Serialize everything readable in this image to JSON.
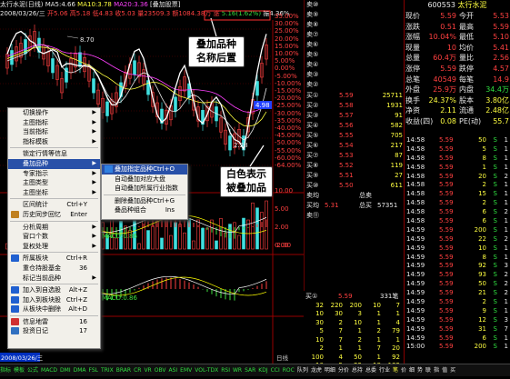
{
  "chart_header": {
    "line1_name": "太行水泥(日线)",
    "line1_ma5": "MA5:4.66",
    "line1_ma10": "MA10:3.78",
    "line1_ma20": "MA20:3.36",
    "line1_tag": "[叠加股票]",
    "line2_date": "2008/03/26/三",
    "line2_vals": "开5.06 高5.18 低4.83 收5.03 量23509.3 额1084.38万 涨",
    "line2_chg": "5.16(1.62%)",
    "line2_amp": "振4.36% 换"
  },
  "chart_marks": {
    "high_label": "8.70",
    "low_label": "2.28",
    "price_tag": "4.98",
    "macd1": "MACD:0.86",
    "macd2": "MACD:0.86",
    "date_label": "2008/03/26/三",
    "period_label": "日线"
  },
  "y_axis": [
    "35.00%",
    "30.00%",
    "25.00%",
    "20.00%",
    "15.00%",
    "10.00%",
    "5.00%",
    "0.00%",
    "-5.00%",
    "-10.00%",
    "-15.00%",
    "-20.00%",
    "-25.00%",
    "-30.00%",
    "-35.00%",
    "-40.00%",
    "-45.00%",
    "-50.00%",
    "-55.00%",
    "-60.00%",
    "-64.00%",
    "10.00",
    "5.00",
    "2.00",
    "0.00",
    "-2.00"
  ],
  "order_book": {
    "sells": [
      [
        "卖⑩",
        "",
        ""
      ],
      [
        "卖⑨",
        "",
        ""
      ],
      [
        "卖⑧",
        "",
        ""
      ],
      [
        "卖⑦",
        "",
        ""
      ],
      [
        "卖⑥",
        "",
        ""
      ],
      [
        "卖⑤",
        "",
        ""
      ],
      [
        "卖④",
        "",
        ""
      ],
      [
        "卖③",
        "",
        ""
      ],
      [
        "卖②",
        "",
        ""
      ]
    ],
    "buys": [
      [
        "买①",
        "5.59",
        "25711"
      ],
      [
        "买②",
        "5.58",
        "1931"
      ],
      [
        "买③",
        "5.57",
        "91"
      ],
      [
        "买④",
        "5.56",
        "582"
      ],
      [
        "买⑤",
        "5.55",
        "705"
      ],
      [
        "买⑥",
        "5.54",
        "217"
      ],
      [
        "买⑦",
        "5.53",
        "87"
      ],
      [
        "买⑧",
        "5.52",
        "119"
      ],
      [
        "买⑨",
        "5.51",
        "27"
      ],
      [
        "买⑩",
        "5.50",
        "611"
      ]
    ],
    "summary1_label": "总卖",
    "summary1": "卖均",
    "summary2_label": "总买",
    "summary2_price": "5.31",
    "summary2_vol": "57351",
    "summary2": "买均",
    "last": "卖⑪"
  },
  "quote": {
    "code": "600553",
    "name": "太行水泥",
    "rows": [
      [
        "现价",
        "5.59",
        "今开",
        "5.53"
      ],
      [
        "涨跌",
        "0.51",
        "最高",
        "5.59"
      ],
      [
        "涨幅",
        "10.04%",
        "最低",
        "5.10"
      ],
      [
        "现量",
        "10",
        "均价",
        "5.41"
      ],
      [
        "总量",
        "60.4万",
        "量比",
        "2.56"
      ],
      [
        "涨停",
        "5.59",
        "跌停",
        "4.57"
      ],
      [
        "总笔",
        "40549",
        "每笔",
        "14.9"
      ],
      [
        "外盘",
        "25.9万",
        "内盘",
        "34.4万"
      ],
      [
        "换手",
        "24.37%",
        "股本",
        "3.80亿"
      ],
      [
        "净资",
        "2.11",
        "流通",
        "2.48亿"
      ],
      [
        "收益(四)",
        "0.08",
        "PE(动)",
        "55.7"
      ]
    ]
  },
  "ticks": [
    [
      "14:58",
      "5.59",
      "50",
      "S",
      "1"
    ],
    [
      "14:58",
      "5.59",
      "5",
      "S",
      "1"
    ],
    [
      "14:58",
      "5.59",
      "8",
      "S",
      "1"
    ],
    [
      "14:58",
      "5.59",
      "1",
      "S",
      "1"
    ],
    [
      "14:58",
      "5.59",
      "20",
      "S",
      "2"
    ],
    [
      "14:58",
      "5.59",
      "2",
      "S",
      "1"
    ],
    [
      "14:58",
      "5.59",
      "15",
      "S",
      "1"
    ],
    [
      "14:58",
      "5.59",
      "2",
      "S",
      "1"
    ],
    [
      "14:58",
      "5.59",
      "6",
      "S",
      "2"
    ],
    [
      "14:58",
      "5.59",
      "6",
      "S",
      "1"
    ],
    [
      "14:59",
      "5.59",
      "200",
      "S",
      "1"
    ],
    [
      "14:59",
      "5.59",
      "22",
      "S",
      "2"
    ],
    [
      "14:59",
      "5.59",
      "10",
      "S",
      "1"
    ],
    [
      "14:59",
      "5.59",
      "8",
      "S",
      "1"
    ],
    [
      "14:59",
      "5.59",
      "92",
      "S",
      "3"
    ],
    [
      "14:59",
      "5.59",
      "93",
      "S",
      "2"
    ],
    [
      "14:59",
      "5.59",
      "50",
      "S",
      "2"
    ],
    [
      "14:59",
      "5.59",
      "21",
      "S",
      "2"
    ],
    [
      "14:59",
      "5.59",
      "2",
      "S",
      "1"
    ],
    [
      "14:59",
      "5.59",
      "9",
      "S",
      "1"
    ],
    [
      "14:59",
      "5.59",
      "12",
      "S",
      "3"
    ],
    [
      "14:59",
      "5.59",
      "31",
      "S",
      "7"
    ],
    [
      "14:59",
      "5.59",
      "6",
      "S",
      "1"
    ],
    [
      "15:00",
      "5.59",
      "200",
      "S",
      "1"
    ]
  ],
  "bottom_panel": {
    "head": [
      "买①",
      "5.59",
      "331笔"
    ],
    "rows": [
      [
        "32",
        "220",
        "200",
        "10",
        "7"
      ],
      [
        "10",
        "30",
        "3",
        "1",
        "1"
      ],
      [
        "30",
        "2",
        "10",
        "1",
        "4"
      ],
      [
        "5",
        "7",
        "1",
        "2",
        "79"
      ],
      [
        "10",
        "7",
        "2",
        "1",
        "1"
      ],
      [
        "2",
        "1",
        "1",
        "7",
        "20"
      ],
      [
        "100",
        "4",
        "50",
        "1",
        "92"
      ],
      [
        "10",
        "5",
        "22",
        "18",
        "132"
      ],
      [
        "11",
        "2",
        "7",
        "2",
        "20"
      ]
    ]
  },
  "menu": {
    "items": [
      [
        "切换操作",
        "",
        "▶"
      ],
      [
        "主图指标",
        "",
        "▶"
      ],
      [
        "当前指标",
        "",
        "▶"
      ],
      [
        "指标模板",
        "",
        "▶"
      ],
      [
        "锁定行情等信息",
        "",
        ""
      ],
      [
        "叠加品种",
        "",
        "▶"
      ],
      [
        "专家指示",
        "",
        "▶"
      ],
      [
        "主图类型",
        "",
        "▶"
      ],
      [
        "主图坐标",
        "",
        "▶"
      ],
      [
        "区间统计",
        "Ctrl+Y",
        ""
      ],
      [
        "历史同步回忆",
        "Enter",
        ""
      ],
      [
        "分析周期",
        "",
        "▶"
      ],
      [
        "窗口个数",
        "",
        "▶"
      ],
      [
        "复权处理",
        "",
        "▶"
      ],
      [
        "所属板块",
        "Ctrl+R",
        ""
      ],
      [
        "重仓持股基金",
        "36",
        ""
      ],
      [
        "标记当前品种",
        "",
        "▶"
      ],
      [
        "加入到自选股",
        "Alt+Z",
        ""
      ],
      [
        "加入到板块股",
        "Ctrl+Z",
        ""
      ],
      [
        "从板块中删除",
        "Alt+D",
        ""
      ],
      [
        "信息地雷",
        "16",
        ""
      ],
      [
        "投资日记",
        "17",
        ""
      ]
    ]
  },
  "submenu": {
    "items": [
      [
        "叠加指定品种",
        "Ctrl+O"
      ],
      [
        "自动叠加对应大盘",
        ""
      ],
      [
        "自动叠加所属行业指数",
        ""
      ],
      [
        "删除叠加品种",
        "Ctrl+G"
      ],
      [
        "叠品种组合",
        "Ins"
      ]
    ]
  },
  "callouts": {
    "top": "叠加品种\n名称后置",
    "bottom": "白色表示\n被叠加品"
  },
  "status_items": [
    "指标",
    "模板",
    "公式",
    "MACD",
    "DMI",
    "DMA",
    "FSL",
    "TRIX",
    "BRAR",
    "CR",
    "VR",
    "OBV",
    "ASI",
    "EMV",
    "VOL-TDX",
    "RSI",
    "WR",
    "SAR",
    "KDJ",
    "CCI",
    "ROC",
    "队列",
    "龙虎",
    "明细",
    "分价",
    "总持",
    "总委",
    "行业",
    "笔",
    "价",
    "细",
    "势",
    "联",
    "指",
    "值",
    "买"
  ],
  "status_highlight": "笔"
}
